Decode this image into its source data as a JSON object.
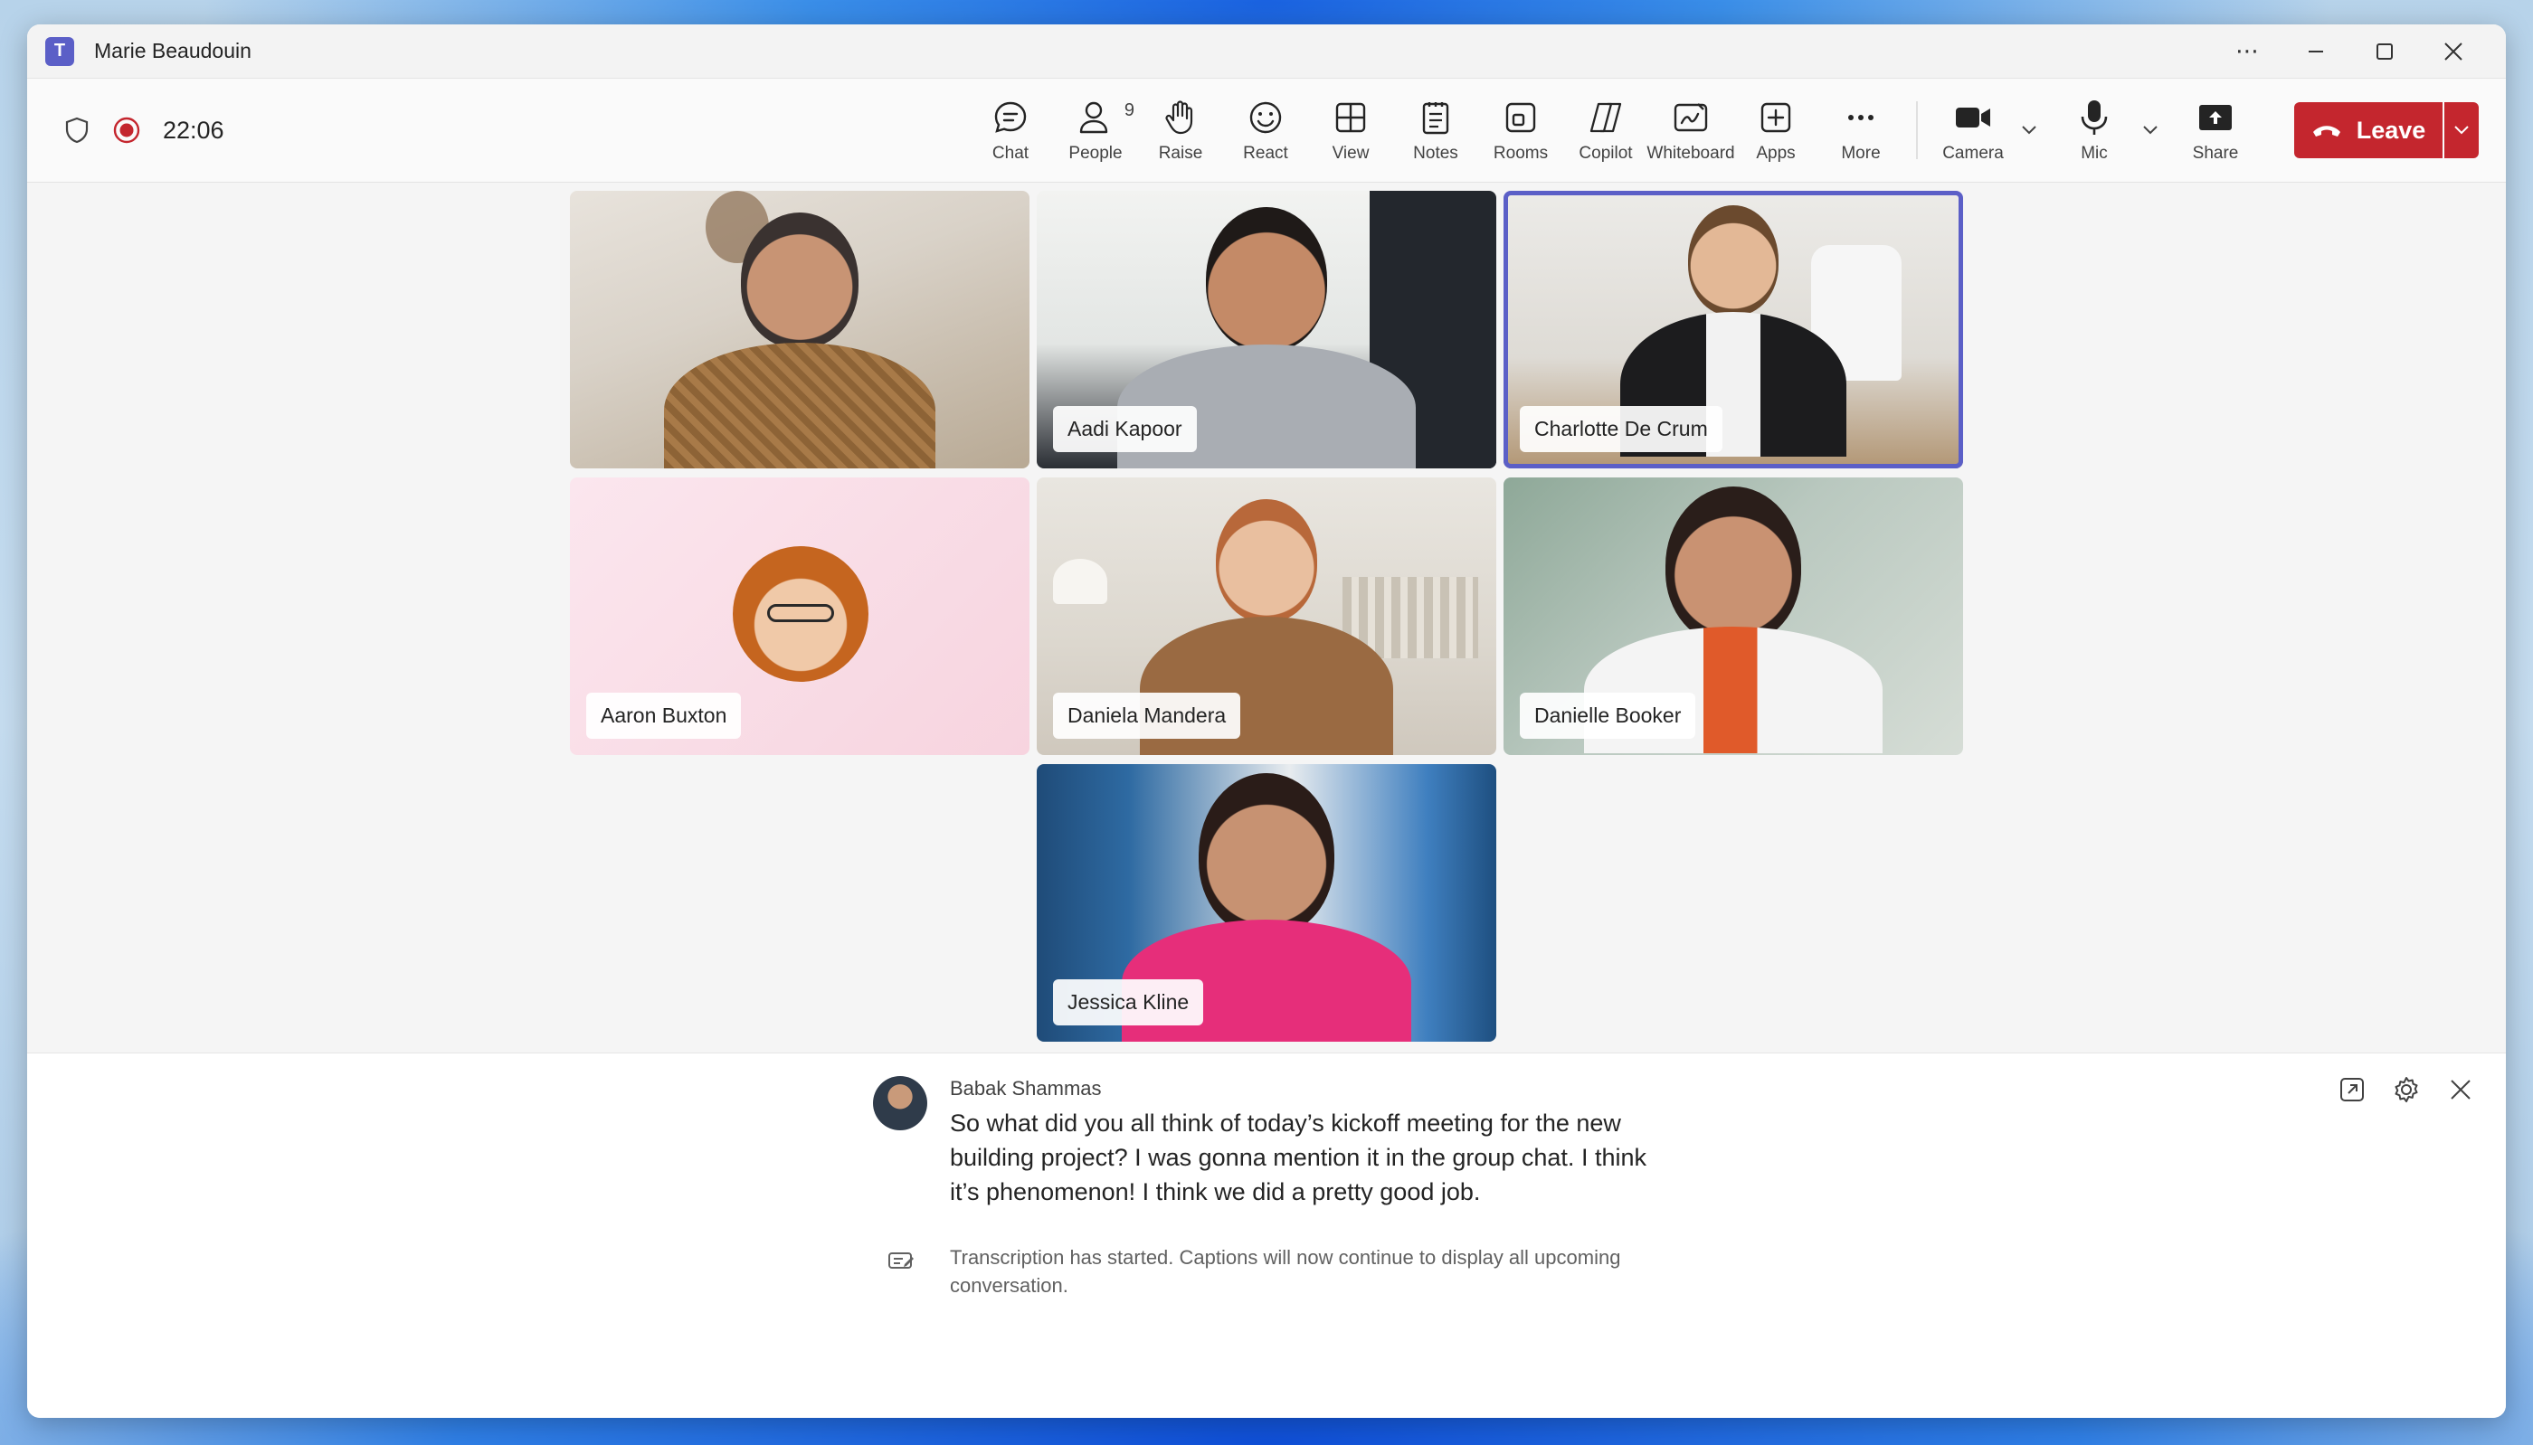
{
  "window": {
    "title": "Marie Beaudouin",
    "app_icon_letter": "T"
  },
  "status": {
    "timer": "22:06"
  },
  "toolbar": {
    "items": [
      {
        "id": "chat",
        "label": "Chat",
        "icon": "chat-bubble-icon"
      },
      {
        "id": "people",
        "label": "People",
        "icon": "people-icon",
        "badge": "9"
      },
      {
        "id": "raise",
        "label": "Raise",
        "icon": "raise-hand-icon"
      },
      {
        "id": "react",
        "label": "React",
        "icon": "smiley-icon"
      },
      {
        "id": "view",
        "label": "View",
        "icon": "grid-view-icon"
      },
      {
        "id": "notes",
        "label": "Notes",
        "icon": "notes-icon"
      },
      {
        "id": "rooms",
        "label": "Rooms",
        "icon": "rooms-icon"
      },
      {
        "id": "copilot",
        "label": "Copilot",
        "icon": "copilot-icon"
      },
      {
        "id": "whiteboard",
        "label": "Whiteboard",
        "icon": "whiteboard-icon"
      },
      {
        "id": "apps",
        "label": "Apps",
        "icon": "apps-plus-icon"
      },
      {
        "id": "more",
        "label": "More",
        "icon": "more-dots-icon"
      }
    ],
    "camera_label": "Camera",
    "mic_label": "Mic",
    "share_label": "Share",
    "leave_label": "Leave"
  },
  "participants": [
    {
      "name": "",
      "active": false
    },
    {
      "name": "Aadi Kapoor",
      "active": false
    },
    {
      "name": "Charlotte De Crum",
      "active": true
    },
    {
      "name": "Aaron Buxton",
      "active": false
    },
    {
      "name": "Daniela Mandera",
      "active": false
    },
    {
      "name": "Danielle Booker",
      "active": false
    },
    {
      "name": "Jessica Kline",
      "active": false
    }
  ],
  "captions": {
    "speaker": "Babak Shammas",
    "text": "So what did you all think of today’s kickoff meeting for the new building project? I was gonna mention it in the group chat. I think it’s phenomenon! I think we did a pretty good job.",
    "notice": "Transcription has started. Captions will now continue to display all upcoming conversation."
  },
  "colors": {
    "accent": "#5b5fc7",
    "leave": "#c4262e",
    "record": "#c4262e"
  }
}
